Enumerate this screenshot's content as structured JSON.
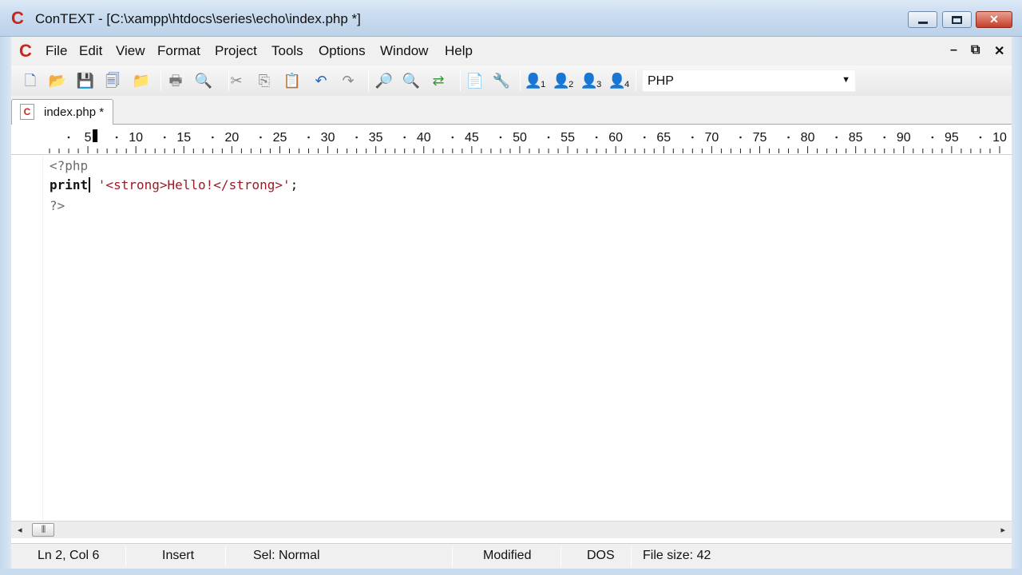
{
  "window": {
    "title": "ConTEXT - [C:\\xampp\\htdocs\\series\\echo\\index.php *]",
    "logo_letter": "C",
    "close_glyph": "✕"
  },
  "menu": {
    "items": [
      "File",
      "Edit",
      "View",
      "Format",
      "Project",
      "Tools",
      "Options",
      "Window",
      "Help"
    ],
    "mdi_minimize": "–",
    "mdi_restore": "⧉",
    "mdi_close": "✕"
  },
  "toolbar": {
    "language": "PHP",
    "icons": [
      {
        "name": "new-file-icon",
        "glyph": "🗋"
      },
      {
        "name": "open-file-icon",
        "glyph": "📂"
      },
      {
        "name": "save-icon",
        "glyph": "💾"
      },
      {
        "name": "save-all-icon",
        "glyph": "🗐"
      },
      {
        "name": "open-folder-icon",
        "glyph": "📁"
      },
      {
        "name": "print-icon",
        "glyph": "🖶"
      },
      {
        "name": "print-preview-icon",
        "glyph": "🔍"
      },
      {
        "name": "cut-icon",
        "glyph": "✂"
      },
      {
        "name": "copy-icon",
        "glyph": "⎘"
      },
      {
        "name": "paste-icon",
        "glyph": "📋"
      },
      {
        "name": "undo-icon",
        "glyph": "↶"
      },
      {
        "name": "redo-icon",
        "glyph": "↷"
      },
      {
        "name": "find-icon",
        "glyph": "🔎"
      },
      {
        "name": "find-next-icon",
        "glyph": "🔍"
      },
      {
        "name": "replace-icon",
        "glyph": "⇄"
      },
      {
        "name": "document-properties-icon",
        "glyph": "📄"
      },
      {
        "name": "tools-icon",
        "glyph": "🔧"
      },
      {
        "name": "user-command-1-icon",
        "glyph": "👤",
        "sub": "1"
      },
      {
        "name": "user-command-2-icon",
        "glyph": "👤",
        "sub": "2"
      },
      {
        "name": "user-command-3-icon",
        "glyph": "👤",
        "sub": "3"
      },
      {
        "name": "user-command-4-icon",
        "glyph": "👤",
        "sub": "4"
      }
    ]
  },
  "tabs": [
    {
      "label": "index.php *",
      "icon_letter": "C"
    }
  ],
  "ruler": {
    "labels": [
      "5",
      "10",
      "15",
      "20",
      "25",
      "30",
      "35",
      "40",
      "45",
      "50",
      "55",
      "60",
      "65",
      "70",
      "75",
      "80",
      "85",
      "90",
      "95",
      "10"
    ]
  },
  "editor": {
    "lines": [
      {
        "segments": [
          {
            "text": "<?php",
            "style": "tag"
          }
        ]
      },
      {
        "segments": [
          {
            "text": "print",
            "style": "kw"
          },
          {
            "text": "",
            "style": "cursor"
          },
          {
            "text": " '<strong>Hello!</strong>'",
            "style": "str"
          },
          {
            "text": ";",
            "style": "plain"
          }
        ]
      },
      {
        "segments": [
          {
            "text": "?>",
            "style": "tag"
          }
        ]
      }
    ]
  },
  "scrollbar": {
    "left_arrow": "◂",
    "right_arrow": "▸",
    "thumb_grip": "|||"
  },
  "status": {
    "position": "Ln 2, Col 6",
    "mode": "Insert",
    "selection": "Sel: Normal",
    "modified": "Modified",
    "line_endings": "DOS",
    "file_size": "File size: 42"
  }
}
